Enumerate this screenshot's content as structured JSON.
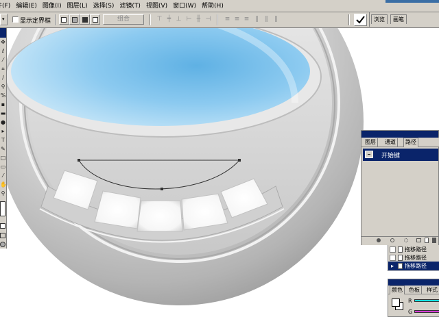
{
  "menu": {
    "items": [
      "件(F)",
      "编辑(E)",
      "图像(I)",
      "图层(L)",
      "选择(S)",
      "滤镜(T)",
      "视图(V)",
      "窗口(W)",
      "帮助(H)"
    ]
  },
  "options": {
    "show_bounding_box": "显示定界框",
    "combine_button": "组合",
    "tab_browser": "浏览",
    "tab_brushes": "画笔"
  },
  "panels": {
    "layers": {
      "tabs": [
        "图层",
        "通道",
        "路径"
      ],
      "active_tab": "路径",
      "path_name": "开始键"
    },
    "history": {
      "rows": [
        "拖移路径",
        "拖移路径",
        "拖移路径"
      ]
    },
    "color": {
      "tabs": [
        "颜色",
        "色板",
        "样式"
      ],
      "r_label": "R",
      "g_label": "G"
    }
  },
  "colors": {
    "chrome": "#d4d0c8",
    "title_active": "#0a246a",
    "r_slider": "#16e0e0",
    "g_slider": "#d63cd6"
  },
  "icons": {
    "toolbox": [
      "move-icon",
      "lasso-icon",
      "magic-wand-icon",
      "crop-icon",
      "brush-icon",
      "stamp-icon",
      "history-brush-icon",
      "eraser-icon",
      "gradient-icon",
      "dodge-icon",
      "path-select-icon",
      "type-icon",
      "pen-icon",
      "shape-icon",
      "notes-icon",
      "eyedropper-icon",
      "hand-icon",
      "zoom-icon"
    ]
  }
}
